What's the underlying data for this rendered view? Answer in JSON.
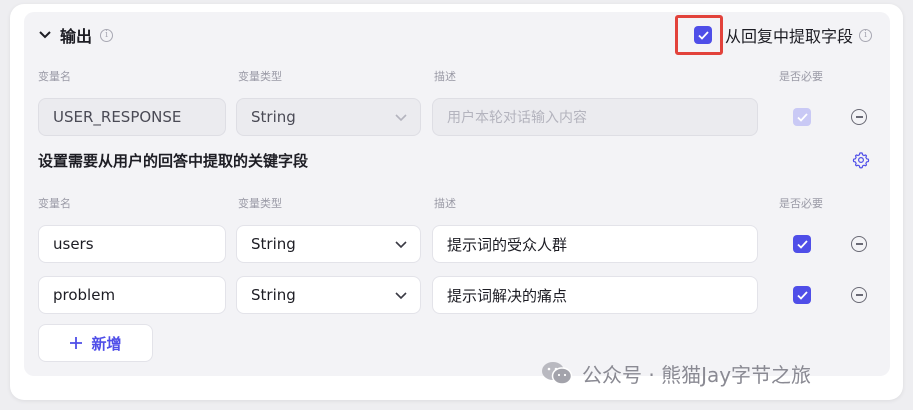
{
  "output": {
    "title": "输出",
    "extract_label": "从回复中提取字段",
    "extract_checked": true
  },
  "headers": {
    "name": "变量名",
    "type": "变量类型",
    "desc": "描述",
    "required": "是否必要"
  },
  "fixed_row": {
    "name": "USER_RESPONSE",
    "type": "String",
    "desc_placeholder": "用户本轮对话输入内容"
  },
  "extraction": {
    "title": "设置需要从用户的回答中提取的关键字段"
  },
  "rows": [
    {
      "name": "users",
      "type": "String",
      "desc": "提示词的受众人群"
    },
    {
      "name": "problem",
      "type": "String",
      "desc": "提示词解决的痛点"
    }
  ],
  "add_button": {
    "label": "新增"
  },
  "watermark": {
    "text": "公众号 · 熊猫Jay字节之旅"
  },
  "colors": {
    "accent": "#4f4ee8",
    "highlight": "#e2423b"
  }
}
